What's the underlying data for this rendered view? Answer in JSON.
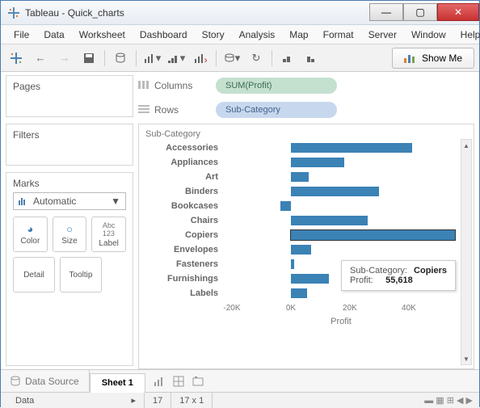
{
  "window": {
    "title": "Tableau - Quick_charts"
  },
  "menu": [
    "File",
    "Data",
    "Worksheet",
    "Dashboard",
    "Story",
    "Analysis",
    "Map",
    "Format",
    "Server",
    "Window",
    "Help"
  ],
  "showme": "Show Me",
  "panels": {
    "pages": "Pages",
    "filters": "Filters",
    "marks": "Marks"
  },
  "marks": {
    "selector": "Automatic",
    "cells": {
      "color": "Color",
      "size": "Size",
      "label": "Label",
      "detail": "Detail",
      "tooltip": "Tooltip"
    }
  },
  "shelves": {
    "columns_label": "Columns",
    "rows_label": "Rows",
    "columns_pill": "SUM(Profit)",
    "rows_pill": "Sub-Category"
  },
  "chart_data": {
    "type": "bar",
    "field_label": "Sub-Category",
    "xlabel": "Profit",
    "xticks": [
      "-20K",
      "0K",
      "20K",
      "40K"
    ],
    "xlim": [
      -23000,
      57000
    ],
    "zero_pct": 28.75,
    "categories": [
      "Accessories",
      "Appliances",
      "Art",
      "Binders",
      "Bookcases",
      "Chairs",
      "Copiers",
      "Envelopes",
      "Fasteners",
      "Furnishings",
      "Labels"
    ],
    "values": [
      41000,
      18000,
      6000,
      30000,
      -3500,
      26000,
      55618,
      7000,
      1000,
      13000,
      5500
    ],
    "highlight_index": 6
  },
  "tooltip": {
    "k1": "Sub-Category:",
    "v1": "Copiers",
    "k2": "Profit:",
    "v2": "55,618"
  },
  "tabs": {
    "datasource": "Data Source",
    "sheet": "Sheet 1"
  },
  "status": {
    "left": "Data",
    "marks": "17",
    "dims": "17 x 1"
  }
}
